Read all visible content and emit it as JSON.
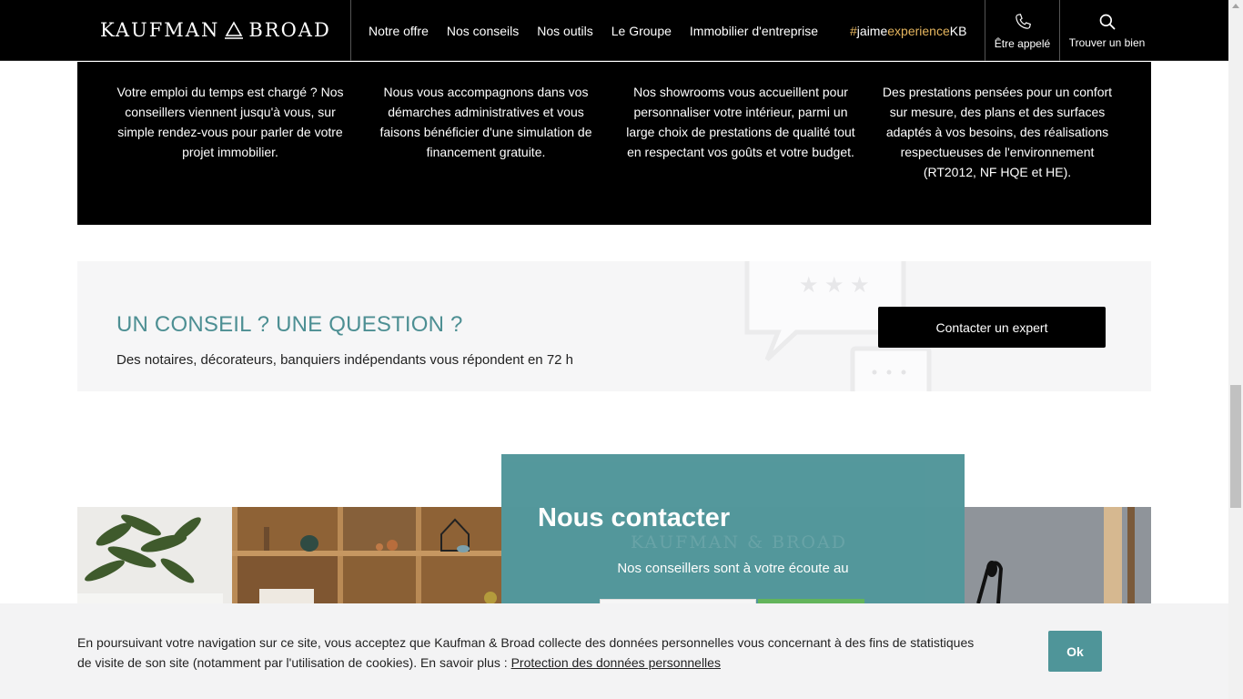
{
  "header": {
    "logo_left": "KAUFMAN",
    "logo_right": "BROAD",
    "nav": [
      "Notre offre",
      "Nos conseils",
      "Nos outils",
      "Le Groupe",
      "Immobilier d'entreprise"
    ],
    "hashtag": {
      "hash": "#",
      "part1": "jaime",
      "part2": "experience",
      "part3": "KB"
    },
    "call_label": "Être appelé",
    "find_label": "Trouver un bien"
  },
  "features": [
    "Votre emploi du temps est chargé ? Nos conseillers viennent jusqu'à vous, sur simple rendez-vous pour parler de votre projet immobilier.",
    "Nous vous accompagnons dans vos démarches administratives et vous faisons bénéficier d'une simulation de financement gratuite.",
    "Nos showrooms vous accueillent pour personnaliser votre intérieur, parmi un large choix de prestations de qualité tout en respectant vos goûts et votre budget.",
    "Des prestations pensées pour un confort sur mesure, des plans et des surfaces adaptés à vos besoins, des réalisations respectueuses de l'environnement (RT2012, NF HQE et HE)."
  ],
  "question": {
    "title": "UN CONSEIL ? UNE QUESTION ?",
    "subtitle": "Des notaires, décorateurs, banquiers indépendants vous répondent en 72 h",
    "button": "Contacter un expert"
  },
  "contact": {
    "title": "Nous contacter",
    "watermark": "KAUFMAN & BROAD",
    "subtitle": "Nos conseillers sont à votre écoute au"
  },
  "cookie": {
    "text": "En poursuivant votre navigation sur ce site, vous acceptez que Kaufman & Broad collecte des données personnelles vous concernant à des fins de statistiques de visite de son site (notamment par l'utilisation de cookies). En savoir plus : ",
    "link": "Protection des données personnelles",
    "ok": "Ok"
  },
  "colors": {
    "accent_teal": "#4f9599",
    "hashtag_gold": "#e5b55e",
    "header_bg": "#000000"
  }
}
